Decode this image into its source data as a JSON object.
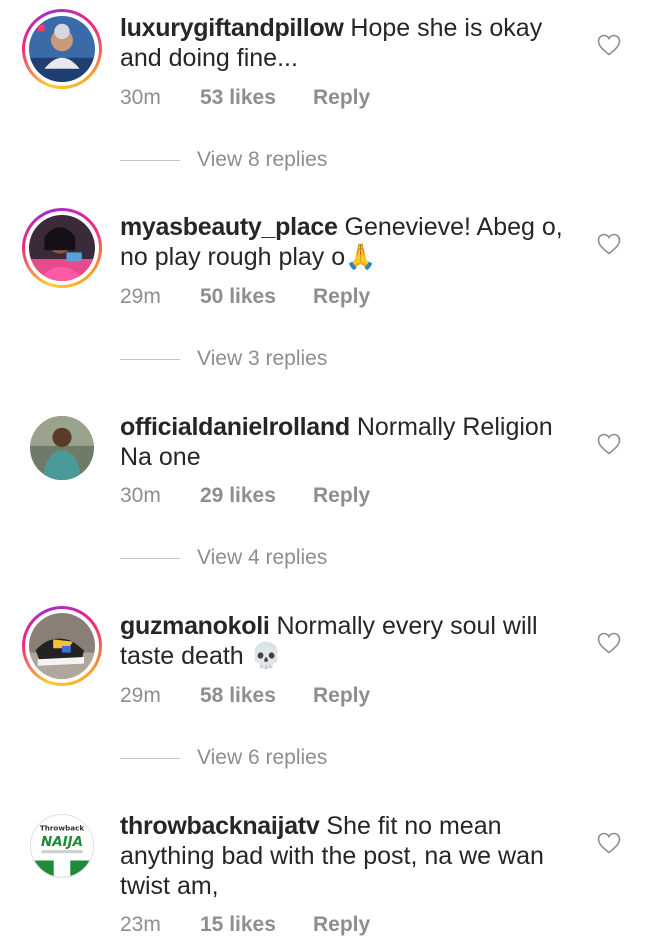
{
  "comments": [
    {
      "username": "luxurygiftandpillow",
      "text": "Hope she is okay and doing fine...",
      "time": "30m",
      "likes": "53 likes",
      "reply": "Reply",
      "view_replies": "View 8 replies",
      "avatar": "story-ring"
    },
    {
      "username": "myasbeauty_place",
      "text": "Genevieve! Abeg o, no play rough play o🙏",
      "time": "29m",
      "likes": "50 likes",
      "reply": "Reply",
      "view_replies": "View 3 replies",
      "avatar": "story-ring"
    },
    {
      "username": "officialdanielrolland",
      "text": "Normally Religion Na one",
      "time": "30m",
      "likes": "29 likes",
      "reply": "Reply",
      "view_replies": "View 4 replies",
      "avatar": "plain"
    },
    {
      "username": "guzmanokoli",
      "text": "Normally every soul will taste death 💀",
      "time": "29m",
      "likes": "58 likes",
      "reply": "Reply",
      "view_replies": "View 6 replies",
      "avatar": "story-ring"
    },
    {
      "username": "throwbacknaijatv",
      "text": "She fit no mean anything bad with the post, na we wan twist am,",
      "time": "23m",
      "likes": "15 likes",
      "reply": "Reply",
      "avatar": "plain",
      "avatar_logo_top": "Throwback",
      "avatar_logo_main": "NAIJA"
    }
  ],
  "colors": {
    "text": "#262626",
    "muted": "#8e8e8e",
    "ring_start": "#f9ce34",
    "ring_mid": "#ee2a7b",
    "ring_end": "#6228d7"
  },
  "icons": {
    "like": "heart-outline-icon"
  }
}
